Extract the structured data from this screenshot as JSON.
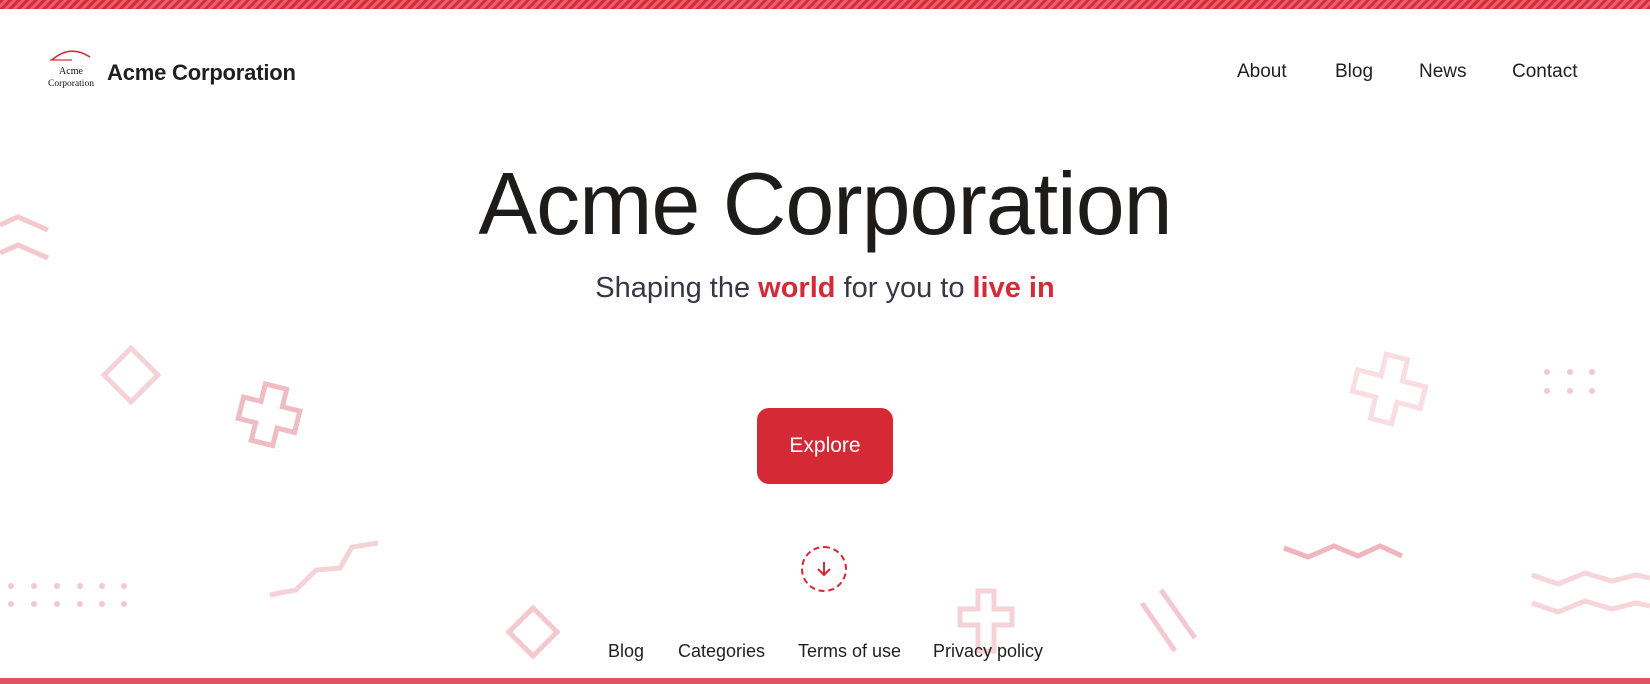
{
  "header": {
    "logo": {
      "line1": "Acme",
      "line2": "Corporation"
    },
    "brand": "Acme Corporation",
    "nav": [
      "About",
      "Blog",
      "News",
      "Contact"
    ]
  },
  "hero": {
    "title": "Acme Corporation",
    "tagline": {
      "part1": "Shaping the ",
      "highlight1": "world",
      "part2": " for you to ",
      "highlight2": "live in"
    },
    "cta_label": "Explore"
  },
  "footer": {
    "links": [
      "Blog",
      "Categories",
      "Terms of use",
      "Privacy policy"
    ]
  },
  "colors": {
    "accent": "#d42b38",
    "decor": "#f2c4cb",
    "text": "#1e1b1b"
  },
  "icons": {
    "scroll": "arrow-down-icon",
    "logo_roof": "roof-icon"
  }
}
